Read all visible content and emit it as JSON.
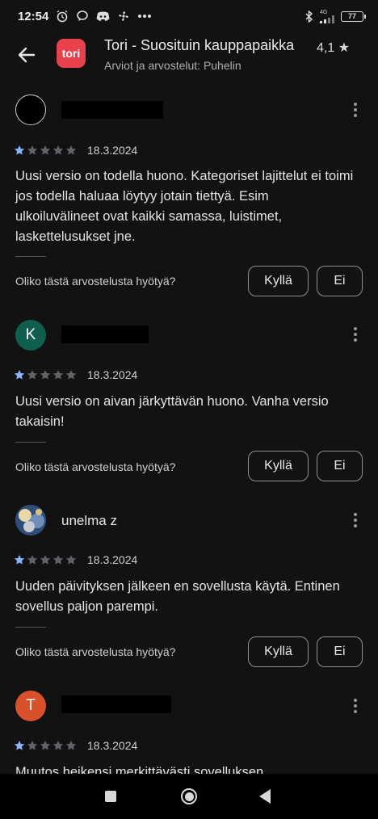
{
  "status_bar": {
    "time": "12:54",
    "network": "4G",
    "battery": "77"
  },
  "app_bar": {
    "title": "Tori - Suosituin kauppapaikka",
    "rating": "4,1 ★",
    "subtitle": "Arviot ja arvostelut: Puhelin",
    "logo_text": "tori"
  },
  "reviews": [
    {
      "avatar_letter": "",
      "name": "",
      "stars": 1,
      "date": "18.3.2024",
      "text": "Uusi versio on todella huono. Kategoriset lajittelut ei toimi jos todella haluaa löytyy jotain tiettyä. Esim ulkoiluvälineet ovat kaikki samassa, luistimet, laskettelusukset jne.",
      "helpful_question": "Oliko tästä arvostelusta hyötyä?",
      "yes_label": "Kyllä",
      "no_label": "Ei"
    },
    {
      "avatar_letter": "K",
      "name": "",
      "stars": 1,
      "date": "18.3.2024",
      "text": "Uusi versio on aivan järkyttävän huono. Vanha versio takaisin!",
      "helpful_question": "Oliko tästä arvostelusta hyötyä?",
      "yes_label": "Kyllä",
      "no_label": "Ei"
    },
    {
      "avatar_letter": "",
      "name": "unelma z",
      "stars": 1,
      "date": "18.3.2024",
      "text": "Uuden päivityksen jälkeen en sovellusta käytä. Entinen sovellus paljon parempi.",
      "helpful_question": "Oliko tästä arvostelusta hyötyä?",
      "yes_label": "Kyllä",
      "no_label": "Ei"
    },
    {
      "avatar_letter": "T",
      "name": "",
      "stars": 1,
      "date": "18.3.2024",
      "text": "Muutos heikensi merkittävästi sovelluksen"
    }
  ],
  "colors": {
    "background": "#121212",
    "star_filled": "#8ab4f8",
    "star_empty": "#5f6368",
    "avatar_k": "#0f5e4e",
    "avatar_t": "#d8512b",
    "logo": "#e8414c"
  }
}
